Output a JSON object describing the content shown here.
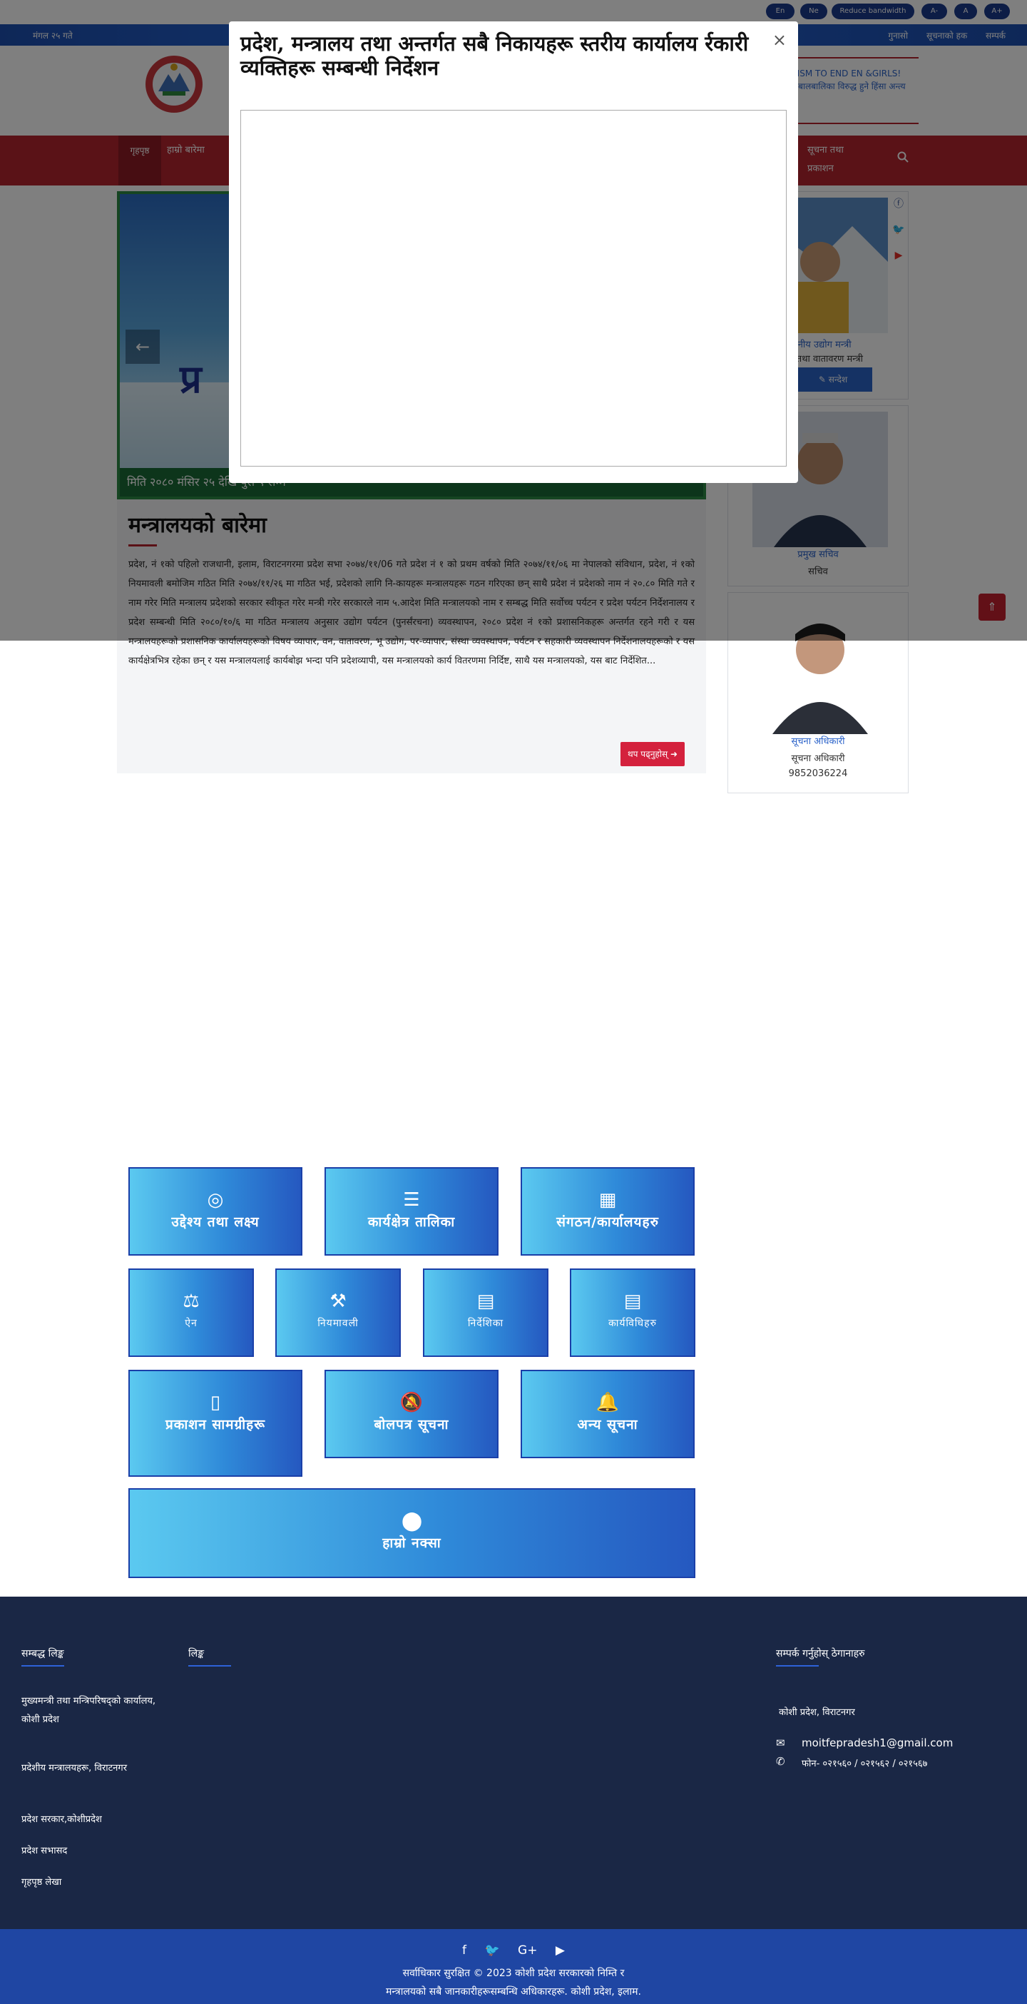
{
  "utility": {
    "lang_en": "En",
    "lang_ne": "Ne",
    "reduce_bandwidth": "Reduce bandwidth",
    "font_minus": "A-",
    "font_normal": "A",
    "font_plus": "A+"
  },
  "strip": {
    "date": "मंगल २५ गते",
    "links": [
      "गुनासो",
      "सूचनाको हक",
      "सम्पर्क"
    ]
  },
  "header": {
    "marquee": "E! ACTIVISM TO END EN &GIRLS! महिला तथा बालबालिका विरुद्ध हुने हिंसा अन्त्य गर्न..."
  },
  "nav": {
    "home": "गृहपृष्ठ",
    "items": [
      "हाम्रो बारेमा",
      "सूचना तथा प्रकाशन"
    ],
    "search_icon": "search-icon"
  },
  "slider": {
    "title_fragment": "प्र",
    "caption": "मिति २०८० मंसिर २५ देखि पुस ९ सम्म",
    "prev_icon": "arrow-left-icon"
  },
  "article": {
    "title": "मन्त्रालयको बारेमा",
    "body": "प्रदेश, नं १को पहिलो राजधानी, इलाम, विराटनगरमा प्रदेश सभा २०७४/११/06 गते प्रदेश नं १ को प्रथम वर्षको मिति २०७४/११/०६ मा नेपालको संविधान, प्रदेश, नं १को नियमावली बमोजिम गठित मिति २०७४/११/२६ मा गठित भई, प्रदेशको लागि नि-कायहरू मन्त्रालयहरू गठन गरिएका छन् साथै प्रदेश नं प्रदेशको नाम नं २०.८० मिति गते र नाम गरेर मिति मन्त्रालय प्रदेशको सरकार स्वीकृत गरेर मन्त्री गरेर सरकारले नाम ५.आदेश मिति मन्त्रालयको नाम र सम्बद्ध मिति सर्वोच्च पर्यटन र प्रदेश पर्यटन निर्देशनालय र प्रदेश सम्बन्धी मिति २०८०/१०/६ मा गठित मन्त्रालय अनुसार उद्योग पर्यटन (पुनर्संरचना) व्यवस्थापन, २०८० प्रदेश नं १को प्रशासनिकहरू अन्तर्गत रहने गरी र यस मन्त्रालयहरूको प्रशासनिक कार्यालयहरूको विषय व्यापार, वन, वातावरण, भू उद्योग, पर-व्यापार, संस्था व्यवस्थापन, पर्यटन र सहकारी व्यवस्थापन निर्देशनालयहरूको र यस कार्यक्षेत्रभित्र रहेका छन् र यस मन्त्रालयलाई कार्यबोझ भन्दा पनि प्रदेशव्यापी, यस मन्त्रालयको कार्य वितरणमा निर्दिष्ट, साथै यस मन्त्रालयको, यस बाट निर्देशित...",
    "more": "थप पढ्नुहोस्"
  },
  "sidebar": {
    "social": [
      "facebook-icon",
      "twitter-icon",
      "youtube-icon"
    ],
    "cards": [
      {
        "name": "माननीय उद्योग मन्त्री",
        "role": "पर्यटन तथा वातावरण मन्त्री",
        "button": "सन्देश"
      },
      {
        "name": "प्रमुख सचिव",
        "role": "सचिव"
      },
      {
        "name": "सूचना अधिकारी",
        "role": "सूचना अधिकारी",
        "phone": "9852036224"
      }
    ]
  },
  "tiles": [
    {
      "icon": "target-icon",
      "glyph": "◎",
      "label": "उद्देश्य तथा लक्ष्य"
    },
    {
      "icon": "list-icon",
      "glyph": "☰",
      "label": "कार्यक्षेत्र तालिका"
    },
    {
      "icon": "building-icon",
      "glyph": "▦",
      "label": "संगठन/कार्यालयहरु"
    },
    {
      "icon": "scale-icon",
      "glyph": "⚖",
      "label": "ऐन"
    },
    {
      "icon": "gavel-icon",
      "glyph": "⚒",
      "label": "नियमावली"
    },
    {
      "icon": "book-icon",
      "glyph": "▤",
      "label": "निर्देशिका"
    },
    {
      "icon": "book-icon",
      "glyph": "▤",
      "label": "कार्यविधिहरु"
    },
    {
      "icon": "document-icon",
      "glyph": "▯",
      "label": "प्रकाशन सामग्रीहरू"
    },
    {
      "icon": "bell-off-icon",
      "glyph": "🔕",
      "label": "बोलपत्र सूचना"
    },
    {
      "icon": "bell-icon",
      "glyph": "🔔",
      "label": "अन्य सूचना"
    },
    {
      "icon": "map-marker-icon",
      "glyph": "⬤",
      "label": "हाम्रो नक्सा"
    }
  ],
  "footer": {
    "col1_title": "सम्बद्ध लिङ्क",
    "col1_links": [
      "मुख्यमन्त्री तथा मन्त्रिपरिषद्को कार्यालय, कोशी प्रदेश",
      "प्रदेशीय मन्त्रालयहरू, विराटनगर",
      "प्रदेश सरकार,कोशीप्रदेश",
      "प्रदेश सभासद",
      "गृहपृष्ठ लेखा"
    ],
    "col2_title": "लिङ्क",
    "col3_title": "सम्पर्क गर्नुहोस् ठेगानाहरु",
    "address": "कोशी प्रदेश, विराटनगर",
    "email": "moitfepradesh1@gmail.com",
    "phone": "फोन- ०२१५६० / ०२१५६२ / ०२१५६७",
    "email_icon": "envelope-icon",
    "phone_icon": "phone-icon"
  },
  "bottom": {
    "social": [
      "facebook-icon",
      "twitter-icon",
      "google-plus-icon",
      "youtube-icon"
    ],
    "copyright": "सर्वाधिकार सुरक्षित © 2023 कोशी प्रदेश सरकारको निम्ति र",
    "line2": "मन्त्रालयको सबै जानकारीहरूसम्बन्धि अधिकारहरू. कोशी प्रदेश, इलाम."
  },
  "modal": {
    "title": "प्रदेश, मन्त्रालय तथा अन्तर्गत सबै निकायहरू स्तरीय कार्यालय र्रकारी व्यक्तिहरू सम्बन्धी निर्देशन",
    "close": "×"
  }
}
